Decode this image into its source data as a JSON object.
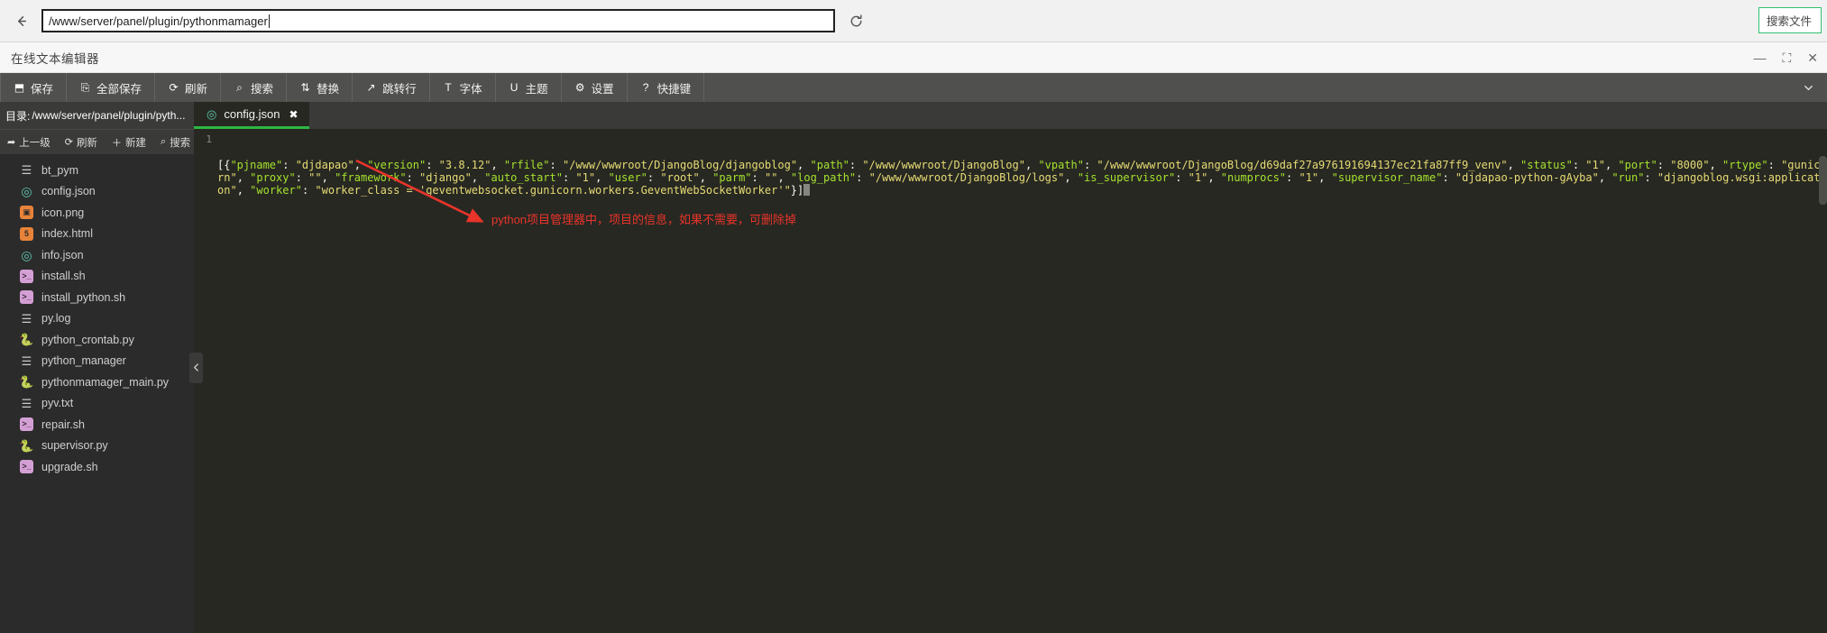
{
  "browser": {
    "back_icon": "arrow-left",
    "url_value": "/www/server/panel/plugin/pythonmamager",
    "url_placeholder": "",
    "reload_icon": "refresh",
    "right_box_text": "搜索文件"
  },
  "window": {
    "title": "在线文本编辑器",
    "minimize_label": "—",
    "maximize_label": "⛶",
    "close_label": "✕"
  },
  "toolbar": {
    "collapse_icon": "chevron-down",
    "items": [
      {
        "label": "保存",
        "icon": "save-icon",
        "glyph": "⬒"
      },
      {
        "label": "全部保存",
        "icon": "save-all-icon",
        "glyph": "⎘"
      },
      {
        "label": "刷新",
        "icon": "refresh-icon",
        "glyph": "⟳"
      },
      {
        "label": "搜索",
        "icon": "search-icon",
        "glyph": "⌕"
      },
      {
        "label": "替换",
        "icon": "replace-icon",
        "glyph": "⇅"
      },
      {
        "label": "跳转行",
        "icon": "goto-line-icon",
        "glyph": "↗"
      },
      {
        "label": "字体",
        "icon": "font-icon",
        "glyph": "T"
      },
      {
        "label": "主题",
        "icon": "theme-icon",
        "glyph": "U"
      },
      {
        "label": "设置",
        "icon": "gear-icon",
        "glyph": "⚙"
      },
      {
        "label": "快捷键",
        "icon": "help-icon",
        "glyph": "?"
      }
    ]
  },
  "sidebar": {
    "path_label": "目录:",
    "path_value": "/www/server/panel/plugin/pyth...",
    "tools": [
      {
        "label": "上一级",
        "icon": "arrow-up-level-icon",
        "glyph": "➦"
      },
      {
        "label": "刷新",
        "icon": "refresh-icon",
        "glyph": "⟳"
      },
      {
        "label": "新建",
        "icon": "plus-icon",
        "glyph": "＋"
      },
      {
        "label": "搜索",
        "icon": "search-icon",
        "glyph": "⌕"
      }
    ],
    "collapse_handle_icon": "chevron-left",
    "files": [
      {
        "name": "bt_pym",
        "type": "doc",
        "glyph": "☰"
      },
      {
        "name": "config.json",
        "type": "json",
        "glyph": "◎"
      },
      {
        "name": "icon.png",
        "type": "png",
        "glyph": "▣"
      },
      {
        "name": "index.html",
        "type": "html",
        "glyph": "5"
      },
      {
        "name": "info.json",
        "type": "json",
        "glyph": "◎"
      },
      {
        "name": "install.sh",
        "type": "sh",
        "glyph": ">_"
      },
      {
        "name": "install_python.sh",
        "type": "sh",
        "glyph": ">_"
      },
      {
        "name": "py.log",
        "type": "doc",
        "glyph": "☰"
      },
      {
        "name": "python_crontab.py",
        "type": "py",
        "glyph": "🐍"
      },
      {
        "name": "python_manager",
        "type": "doc",
        "glyph": "☰"
      },
      {
        "name": "pythonmamager_main.py",
        "type": "py",
        "glyph": "🐍"
      },
      {
        "name": "pyv.txt",
        "type": "doc",
        "glyph": "☰"
      },
      {
        "name": "repair.sh",
        "type": "sh",
        "glyph": ">_"
      },
      {
        "name": "supervisor.py",
        "type": "py",
        "glyph": "🐍"
      },
      {
        "name": "upgrade.sh",
        "type": "sh",
        "glyph": ">_"
      }
    ]
  },
  "editor": {
    "tab": {
      "name": "config.json",
      "icon": "json-file-icon",
      "glyph": "◎",
      "close_glyph": "✖",
      "active_underline_color": "#2db742"
    },
    "line_number": "1",
    "content_json": {
      "pjname": "djdapao",
      "version": "3.8.12",
      "rfile": "/www/wwwroot/DjangoBlog/djangoblog",
      "path": "/www/wwwroot/DjangoBlog",
      "vpath": "/www/wwwroot/DjangoBlog/d69daf27a976191694137ec21fa87ff9_venv",
      "status": "1",
      "port": "8000",
      "rtype": "gunicorn",
      "proxy": "",
      "framework": "django",
      "auto_start": "1",
      "user": "root",
      "parm": "",
      "log_path": "/www/wwwroot/DjangoBlog/logs",
      "is_supervisor": "1",
      "numprocs": "1",
      "supervisor_name": "djdapao-python-gAyba",
      "run": "djangoblog.wsgi:application",
      "worker": "worker_class = 'geventwebsocket.gunicorn.workers.GeventWebSocketWorker'"
    },
    "annotation": {
      "text": "python项目管理器中，项目的信息，如果不需要，可删除掉",
      "color": "#e8342a",
      "arrow_color": "#e8342a"
    }
  },
  "colors": {
    "editor_bg": "#272822",
    "sidebar_bg": "#2b2b2b",
    "toolbar_bg": "#50504f",
    "accent_green": "#2db742",
    "json_key": "#a6e22e",
    "json_value": "#e6db74"
  }
}
